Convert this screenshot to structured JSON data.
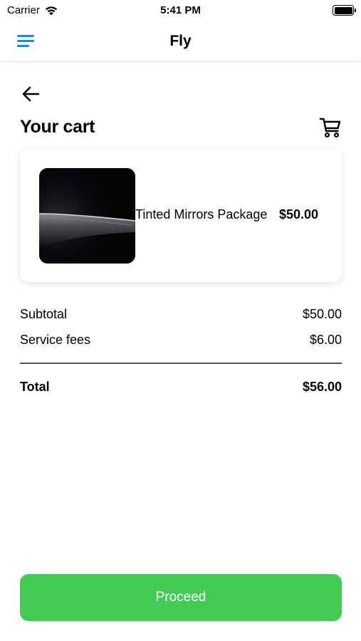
{
  "status_bar": {
    "carrier": "Carrier",
    "time": "5:41 PM"
  },
  "nav": {
    "title": "Fly",
    "menu_icon": "hamburger-menu-icon",
    "accent_color": "#1a86e5"
  },
  "page": {
    "back_icon": "arrow-left-icon",
    "title": "Your cart",
    "cart_icon": "shopping-cart-icon"
  },
  "cart": {
    "items": [
      {
        "name": "Tinted Mirrors Package",
        "price": "$50.00",
        "image": "dark-aircraft-photo"
      }
    ]
  },
  "summary": {
    "subtotal_label": "Subtotal",
    "subtotal_value": "$50.00",
    "fees_label": "Service fees",
    "fees_value": "$6.00",
    "total_label": "Total",
    "total_value": "$56.00"
  },
  "actions": {
    "proceed_label": "Proceed",
    "proceed_color": "#43cc55"
  }
}
